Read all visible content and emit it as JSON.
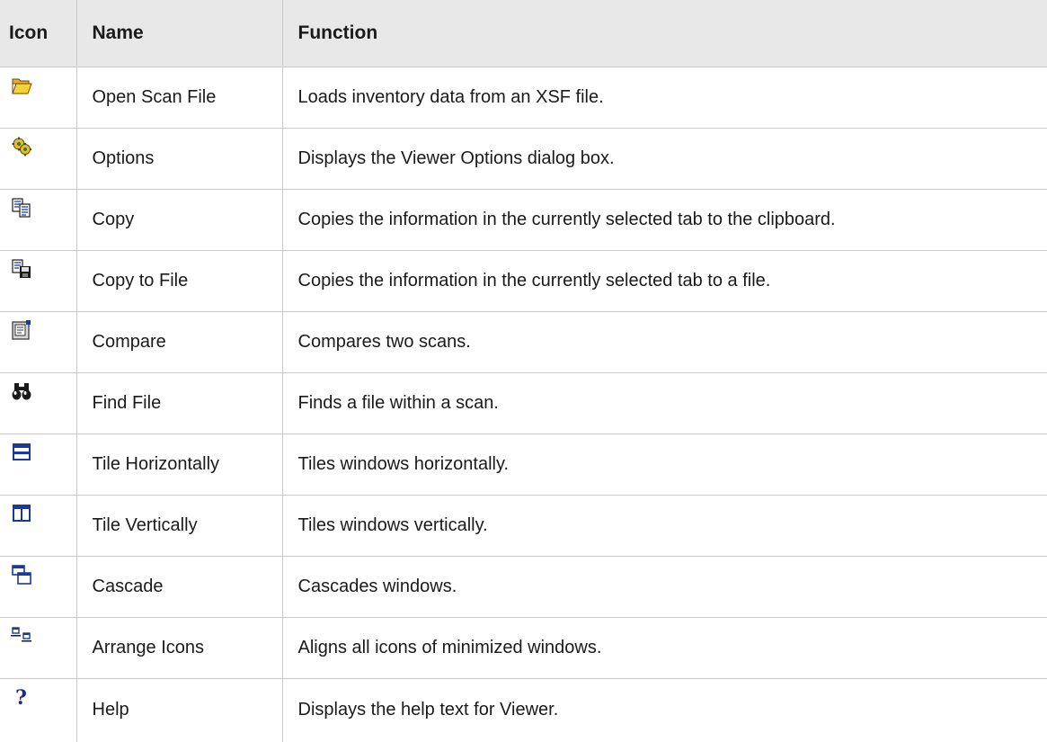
{
  "table": {
    "headers": {
      "icon": "Icon",
      "name": "Name",
      "function": "Function"
    },
    "rows": [
      {
        "icon": "open-folder-icon",
        "name": "Open Scan File",
        "function": "Loads inventory data from an XSF file."
      },
      {
        "icon": "gears-icon",
        "name": "Options",
        "function": "Displays the Viewer Options dialog box."
      },
      {
        "icon": "copy-icon",
        "name": "Copy",
        "function": "Copies the information in the currently selected tab to the clipboard."
      },
      {
        "icon": "copy-to-file-icon",
        "name": "Copy to File",
        "function": "Copies the information in the currently selected tab to a file."
      },
      {
        "icon": "compare-icon",
        "name": "Compare",
        "function": "Compares two scans."
      },
      {
        "icon": "binoculars-icon",
        "name": "Find File",
        "function": "Finds a file within a scan."
      },
      {
        "icon": "tile-horizontal-icon",
        "name": "Tile Horizontally",
        "function": "Tiles windows horizontally."
      },
      {
        "icon": "tile-vertical-icon",
        "name": "Tile Vertically",
        "function": "Tiles windows vertically."
      },
      {
        "icon": "cascade-icon",
        "name": "Cascade",
        "function": "Cascades windows."
      },
      {
        "icon": "arrange-icons-icon",
        "name": "Arrange Icons",
        "function": "Aligns all icons of minimized windows."
      },
      {
        "icon": "help-icon",
        "name": "Help",
        "function": "Displays the help text for Viewer."
      }
    ]
  },
  "colors": {
    "header_bg": "#e8e8e8",
    "border": "#c8c8c8",
    "window_icon_blue": "#1a3a9a"
  }
}
